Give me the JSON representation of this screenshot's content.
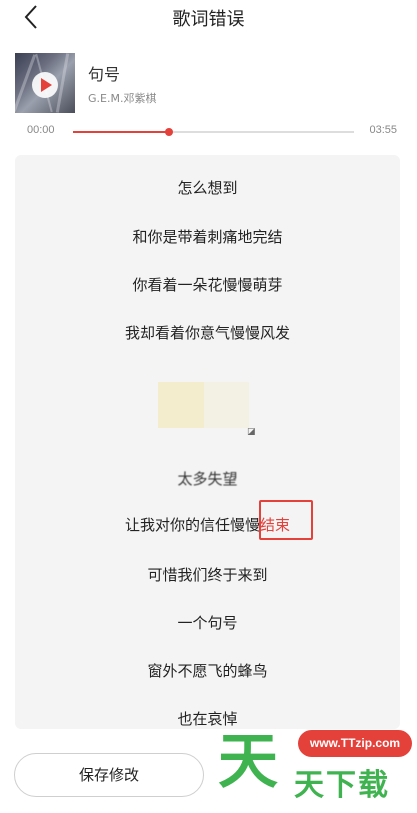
{
  "header": {
    "title": "歌词错误",
    "back_icon": "chevron-left-icon"
  },
  "song": {
    "name": "句号",
    "artist": "G.E.M.邓紫棋",
    "cover_icon": "play-icon"
  },
  "player": {
    "current_time": "00:00",
    "total_time": "03:55",
    "progress_fraction": 0.34,
    "accent_color": "#e5413b"
  },
  "lyrics": {
    "lines": [
      "怎么想到",
      "和你是带着刺痛地完结",
      "你看着一朵花慢慢萌芽",
      "我却看着你意气慢慢风发",
      "太多失望",
      "可惜我们终于来到",
      "一个句号",
      "窗外不愿飞的蜂鸟",
      "也在哀悼"
    ],
    "edited_line_prefix": "让我对你的信任慢慢",
    "edited_word": "结束"
  },
  "actions": {
    "save_label": "保存修改"
  },
  "watermark": {
    "badge": "www.TTzip.com",
    "big_char": "天",
    "text": "天下载",
    "color": "#3fb34f"
  }
}
